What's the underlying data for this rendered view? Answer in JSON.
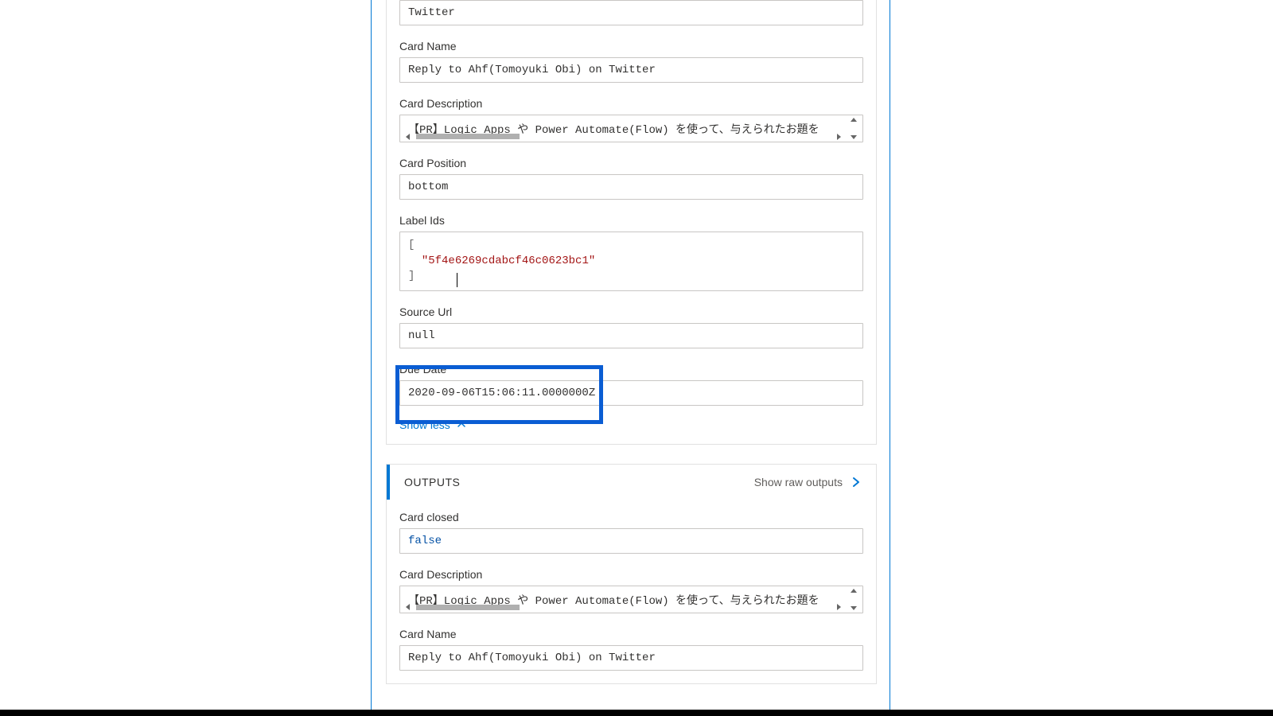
{
  "inputs": {
    "twitter_value": "Twitter",
    "card_name_label": "Card Name",
    "card_name_value": "Reply to Ahf(Tomoyuki Obi) on Twitter",
    "card_description_label": "Card Description",
    "card_description_value": "【PR】Logic Apps や Power Automate(Flow) を使って、与えられたお題を",
    "card_position_label": "Card Position",
    "card_position_value": "bottom",
    "label_ids_label": "Label Ids",
    "label_ids_open": "[",
    "label_ids_value": "\"5f4e6269cdabcf46c0623bc1\"",
    "label_ids_close": "]",
    "source_url_label": "Source Url",
    "source_url_value": "null",
    "due_date_label": "Due Date",
    "due_date_value": "2020-09-06T15:06:11.0000000Z",
    "show_less": "Show less"
  },
  "outputs": {
    "title": "OUTPUTS",
    "show_raw": "Show raw outputs",
    "card_closed_label": "Card closed",
    "card_closed_value": "false",
    "card_description_label": "Card Description",
    "card_description_value": "【PR】Logic Apps や Power Automate(Flow) を使って、与えられたお題を",
    "card_name_label": "Card Name",
    "card_name_value": "Reply to Ahf(Tomoyuki Obi) on Twitter"
  }
}
